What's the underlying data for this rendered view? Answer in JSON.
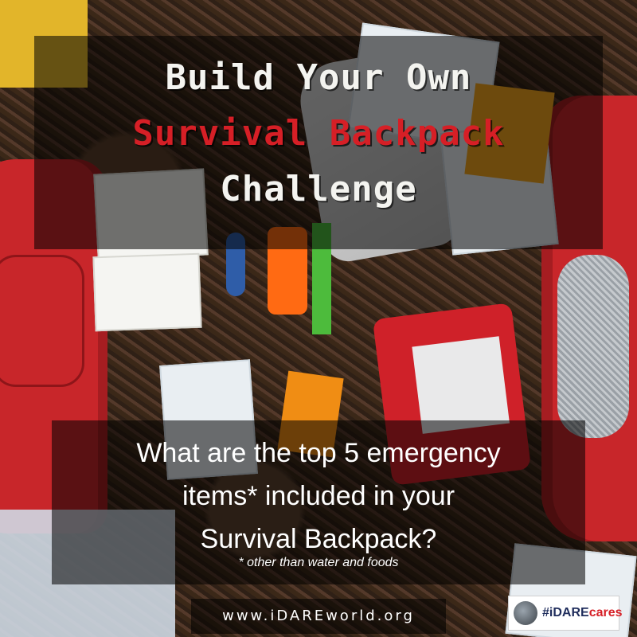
{
  "title": {
    "line1": "Build Your Own",
    "line2": "Survival Backpack",
    "line3": "Challenge"
  },
  "question": {
    "line1": "What are the top 5 emergency",
    "line2": "items* included in your",
    "line3": "Survival Backpack?",
    "footnote": "* other than water and foods"
  },
  "footer": {
    "url": "www.iDAREworld.org",
    "badge_prefix": "#iDARE",
    "badge_accent": "cares"
  },
  "colors": {
    "title_red": "#d61f26",
    "overlay": "rgba(0,0,0,0.55)",
    "backpack_red": "#c8262a"
  }
}
